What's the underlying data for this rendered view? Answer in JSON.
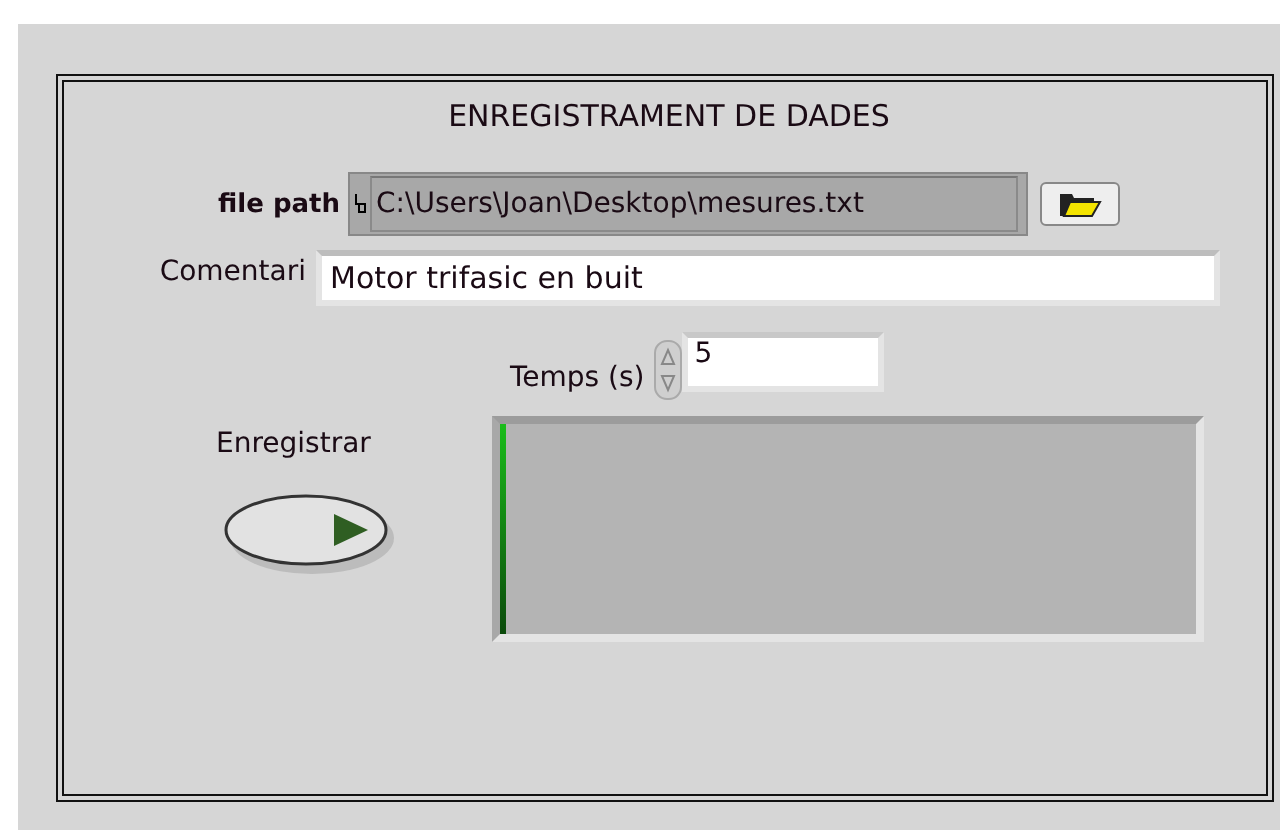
{
  "panel": {
    "title": "ENREGISTRAMENT DE DADES"
  },
  "file_path": {
    "label": "file path",
    "value": "C:\\Users\\Joan\\Desktop\\mesures.txt"
  },
  "comment": {
    "label": "Comentari",
    "value": "Motor trifasic en buit"
  },
  "time": {
    "label": "Temps (s)",
    "value": "5"
  },
  "record": {
    "label": "Enregistrar",
    "on": false
  },
  "progress": {
    "level": 0.01
  }
}
